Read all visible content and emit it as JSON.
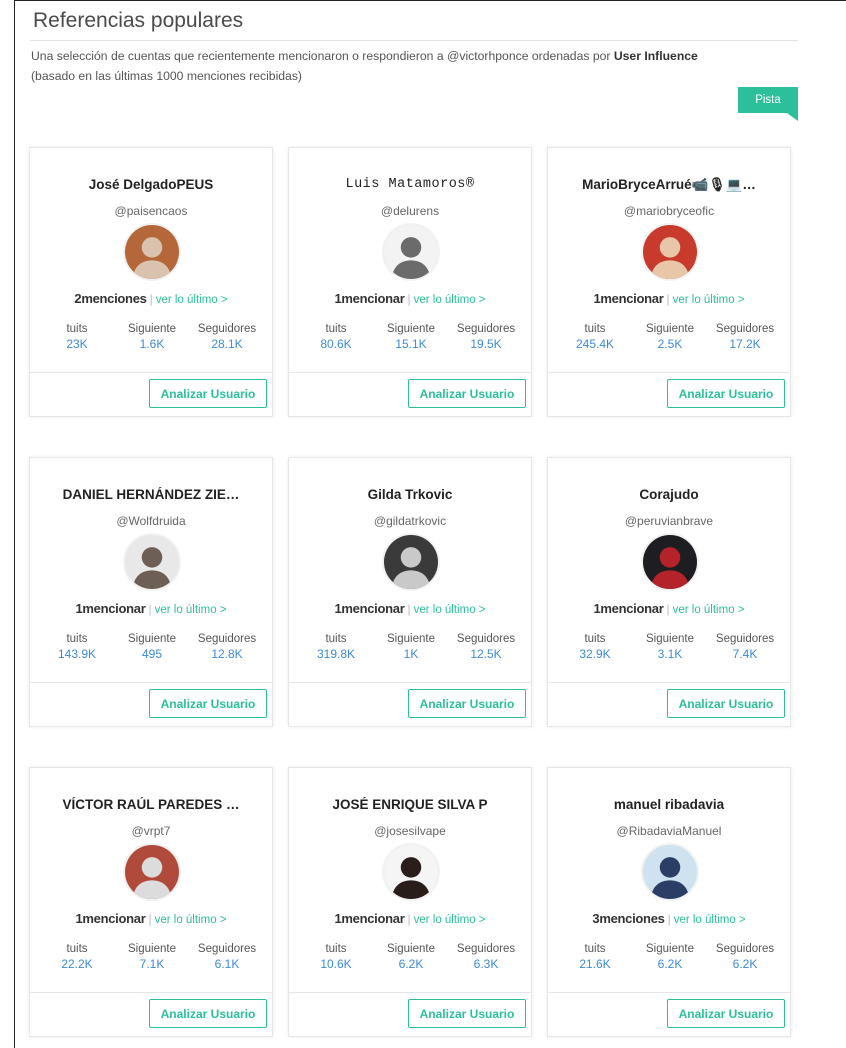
{
  "header": {
    "title": "Referencias populares",
    "description_prefix": "Una selección de cuentas que recientemente mencionaron o respondieron a @victorhponce ordenadas por ",
    "description_bold": "User Influence",
    "description_suffix": "(basado en las últimas 1000 menciones recibidas)",
    "hint_label": "Pista"
  },
  "labels": {
    "tweets": "tuits",
    "following": "Siguiente",
    "followers": "Seguidores",
    "see_last": "ver lo último >",
    "separator": "|",
    "analyze": "Analizar Usuario"
  },
  "cards": [
    {
      "name": "José DelgadoPEUS",
      "handle": "@paisencaos",
      "mentions": "2menciones",
      "tweets": "23K",
      "following": "1.6K",
      "followers": "28.1K",
      "avatar_bg": "#b5673a",
      "avatar_fg": "#d9c3ae",
      "avatar_icon": "elderly-man-avatar"
    },
    {
      "name": "Luis Matamoros®",
      "handle": "@delurens",
      "mentions": "1mencionar",
      "tweets": "80.6K",
      "following": "15.1K",
      "followers": "19.5K",
      "avatar_bg": "#f3f3f3",
      "avatar_fg": "#6b6b6b",
      "avatar_icon": "sunglasses-man-avatar"
    },
    {
      "name": "MarioBryceArrué📹🎙💻…",
      "handle": "@mariobryceofic",
      "mentions": "1mencionar",
      "tweets": "245.4K",
      "following": "2.5K",
      "followers": "17.2K",
      "avatar_bg": "#c83a2b",
      "avatar_fg": "#e8c7a8",
      "avatar_icon": "glasses-man-avatar"
    },
    {
      "name": "DANIEL HERNÁNDEZ ZIE…",
      "handle": "@Wolfdruida",
      "mentions": "1mencionar",
      "tweets": "143.9K",
      "following": "495",
      "followers": "12.8K",
      "avatar_bg": "#e8e8e8",
      "avatar_fg": "#6d5f55",
      "avatar_icon": "bald-man-avatar"
    },
    {
      "name": "Gilda Trkovic",
      "handle": "@gildatrkovic",
      "mentions": "1mencionar",
      "tweets": "319.8K",
      "following": "1K",
      "followers": "12.5K",
      "avatar_bg": "#3a3a3a",
      "avatar_fg": "#c9c9c9",
      "avatar_icon": "woman-avatar"
    },
    {
      "name": "Corajudo",
      "handle": "@peruvianbrave",
      "mentions": "1mencionar",
      "tweets": "32.9K",
      "following": "3.1K",
      "followers": "7.4K",
      "avatar_bg": "#1e1e22",
      "avatar_fg": "#b5232a",
      "avatar_icon": "dark-poster-avatar"
    },
    {
      "name": "VÍCTOR RAÚL PAREDES …",
      "handle": "@vrpt7",
      "mentions": "1mencionar",
      "tweets": "22.2K",
      "following": "7.1K",
      "followers": "6.1K",
      "avatar_bg": "#b04a3a",
      "avatar_fg": "#dcdcdc",
      "avatar_icon": "building-avatar"
    },
    {
      "name": "JOSÉ ENRIQUE SILVA P",
      "handle": "@josesilvape",
      "mentions": "1mencionar",
      "tweets": "10.6K",
      "following": "6.2K",
      "followers": "6.3K",
      "avatar_bg": "#f5f5f5",
      "avatar_fg": "#2a1e1a",
      "avatar_icon": "suit-man-avatar"
    },
    {
      "name": "manuel ribadavia",
      "handle": "@RibadaviaManuel",
      "mentions": "3menciones",
      "tweets": "21.6K",
      "following": "6.2K",
      "followers": "6.2K",
      "avatar_bg": "#cfe2f0",
      "avatar_fg": "#2b3f66",
      "avatar_icon": "motorcycle-avatar"
    }
  ]
}
